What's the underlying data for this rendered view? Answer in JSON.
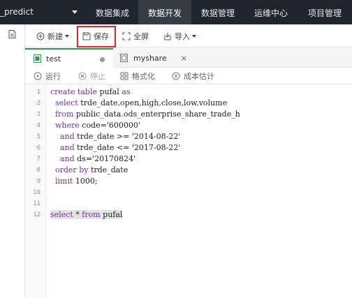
{
  "topbar": {
    "project_name": "_predict",
    "nav": [
      {
        "label": "数据集成",
        "active": false
      },
      {
        "label": "数据开发",
        "active": true
      },
      {
        "label": "数据管理",
        "active": false
      },
      {
        "label": "运维中心",
        "active": false
      },
      {
        "label": "项目管理",
        "active": false
      }
    ]
  },
  "toolbar": {
    "new_label": "新建",
    "save_label": "保存",
    "fullscreen_label": "全屏",
    "import_label": "导入"
  },
  "tabs": [
    {
      "label": "test",
      "active": true,
      "icon": "sql-file-icon",
      "modified": true
    },
    {
      "label": "myshare",
      "active": false,
      "icon": "sql-file-icon",
      "modified": false
    }
  ],
  "tab_close_glyph": "×",
  "runbar": {
    "run_label": "运行",
    "stop_label": "停止",
    "format_label": "格式化",
    "cost_label": "成本估计"
  },
  "editor": {
    "lines": [
      {
        "n": "1",
        "text": "create table pufal as"
      },
      {
        "n": "2",
        "text": "  select trde_date,open,high,close,low,volume"
      },
      {
        "n": "3",
        "text": "  from public_data.ods_enterprise_share_trade_h"
      },
      {
        "n": "4",
        "text": "  where code='600000'"
      },
      {
        "n": "5",
        "text": "    and trde_date >= '2014-08-22'"
      },
      {
        "n": "6",
        "text": "    and trde_date <= '2017-08-22'"
      },
      {
        "n": "7",
        "text": "    and ds='20170824'"
      },
      {
        "n": "8",
        "text": "  order by trde_date"
      },
      {
        "n": "9",
        "text": "  limit 1000;"
      },
      {
        "n": "10",
        "text": ""
      },
      {
        "n": "11",
        "text": ""
      },
      {
        "n": "12",
        "text": "select * from pufal"
      }
    ]
  },
  "colors": {
    "topbar_bg": "#20242b",
    "active_nav_bg": "#373c44",
    "highlight_border": "#e3262b",
    "keyword": "#7b2bb0",
    "tab_accent": "#2b9a4a"
  }
}
